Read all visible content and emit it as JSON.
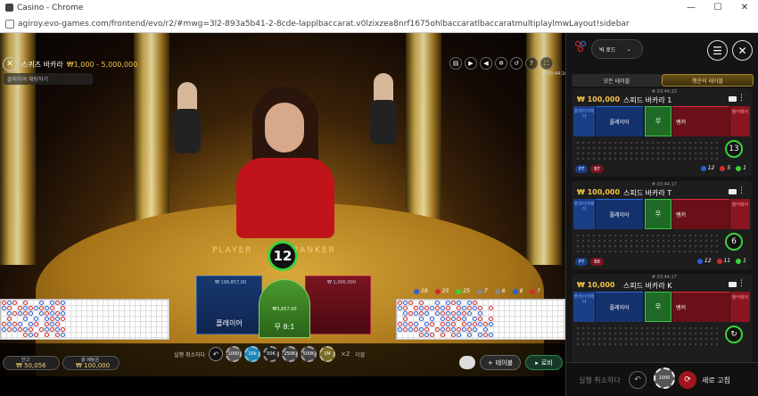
{
  "browser": {
    "window_title": "Casino - Chrome",
    "url": "agiroy.evo-games.com/frontend/evo/r2/#mwg=3l2-893a5b41-2-8cde-lapplbaccarat.v0lzixzea8nrf1675ohlbaccaratlbaccaratmultiplaylmwLayout!sidebar",
    "controls": [
      "—",
      "☐",
      "✕"
    ]
  },
  "video": {
    "table_name": "스퀴즈 바카라",
    "table_limit": "₩1,000 - 5,000,000",
    "chat_placeholder": "클릭하여 채팅하기",
    "stream_code": "# 03:44:16",
    "table_left_text": "PLAYER",
    "table_right_text": "BANKER",
    "timer": "12"
  },
  "betting": {
    "player_label": "플레이어",
    "tie_label": "무 8:1",
    "player_mini": "₩ 198,857,00",
    "banker_mini": "₩ 1,000,000",
    "tie_mini": "₩3,657,00"
  },
  "road_stats": {
    "items": [
      {
        "color": "#2b5fd6",
        "value": "19"
      },
      {
        "color": "#d62b2b",
        "value": "25"
      },
      {
        "color": "#3bd23b",
        "value": "25"
      },
      {
        "color": "#888888",
        "value": "7"
      },
      {
        "color": "#888888",
        "value": "6"
      },
      {
        "color": "#2b5fd6",
        "value": "6"
      },
      {
        "color": "#d62b2b",
        "value": "?"
      }
    ]
  },
  "bottom": {
    "balance_label": "잔고",
    "balance_value": "₩ 50,056",
    "totalbet_label": "총 베팅금",
    "totalbet_value": "₩ 100,000",
    "undo_label": "실행 취소하다",
    "chips": [
      {
        "label": "1000",
        "color": "#555555"
      },
      {
        "label": "10k",
        "color": "#1f86b8"
      },
      {
        "label": "50K",
        "color": "#222222"
      },
      {
        "label": "250K",
        "color": "#444444"
      },
      {
        "label": "500K",
        "color": "#444444"
      },
      {
        "label": "1M",
        "color": "#7a6a2a"
      }
    ],
    "x2_label": "×2",
    "repeat_label": "더블",
    "table_button": "테이블",
    "lobby_button": "로비"
  },
  "sidebar": {
    "road_select": "빅 로드",
    "tabs": [
      "모든 테이블",
      "행운의 테이블"
    ],
    "cards": [
      {
        "id": "# 03:44:23",
        "limit": "₩ 100,000",
        "name": "스피드 바카라 1",
        "p_box": "플레이어페어",
        "player": "플레이어",
        "tie": "무",
        "banker": "뱅커",
        "b_box": "뱅커페어",
        "timer": "13",
        "pill_p": "P7",
        "pill_b": "B7",
        "stat_b": "12",
        "stat_r": "5",
        "stat_g": "1"
      },
      {
        "id": "# 03:44:17",
        "limit": "₩ 100,000",
        "name": "스피드 바카라 T",
        "p_box": "플레이어페어",
        "player": "플레이어",
        "tie": "무",
        "banker": "뱅커",
        "b_box": "뱅커페어",
        "timer": "6",
        "pill_p": "P7",
        "pill_b": "B8",
        "stat_b": "12",
        "stat_r": "11",
        "stat_g": "1"
      },
      {
        "id": "# 03:44:17",
        "limit": "₩ 10,000",
        "name": "스피드 바카라 K",
        "p_box": "플레이어페어",
        "player": "플레이어",
        "tie": "무",
        "banker": "뱅커",
        "b_box": "뱅커페어",
        "timer": "",
        "pill_p": "",
        "pill_b": "",
        "stat_b": "",
        "stat_r": "",
        "stat_g": ""
      }
    ],
    "bottom_undo": "실행 취소하다",
    "bottom_chip": "1000",
    "bottom_refresh": "새로 고침"
  }
}
